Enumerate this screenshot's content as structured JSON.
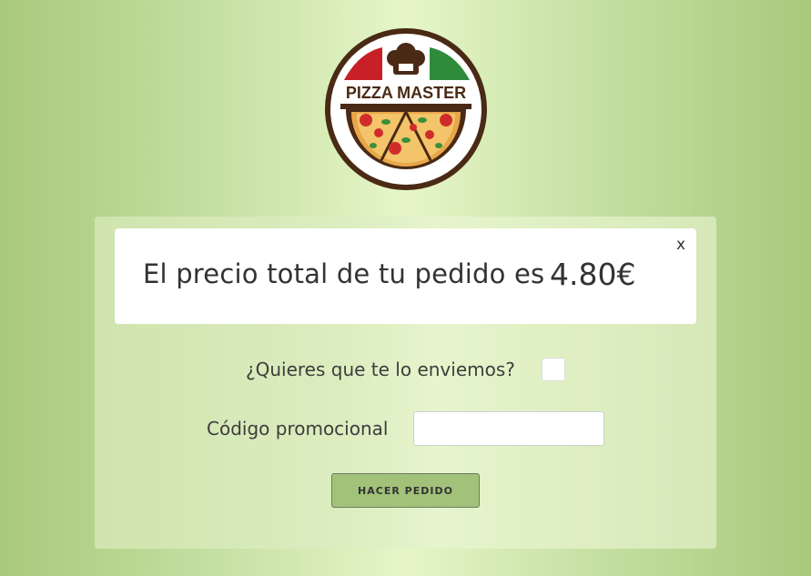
{
  "logo": {
    "text": "PIZZA MASTER",
    "ring_color": "#4a2a14",
    "red": "#c72027",
    "green": "#2e8b3a"
  },
  "alert": {
    "message": "El precio total de tu pedido es",
    "price": "4.80€",
    "close_label": "x"
  },
  "form": {
    "shipping_label": "¿Quieres que te lo enviemos?",
    "shipping_checked": false,
    "promo_label": "Código promocional",
    "promo_value": "",
    "submit_label": "HACER PEDIDO"
  }
}
